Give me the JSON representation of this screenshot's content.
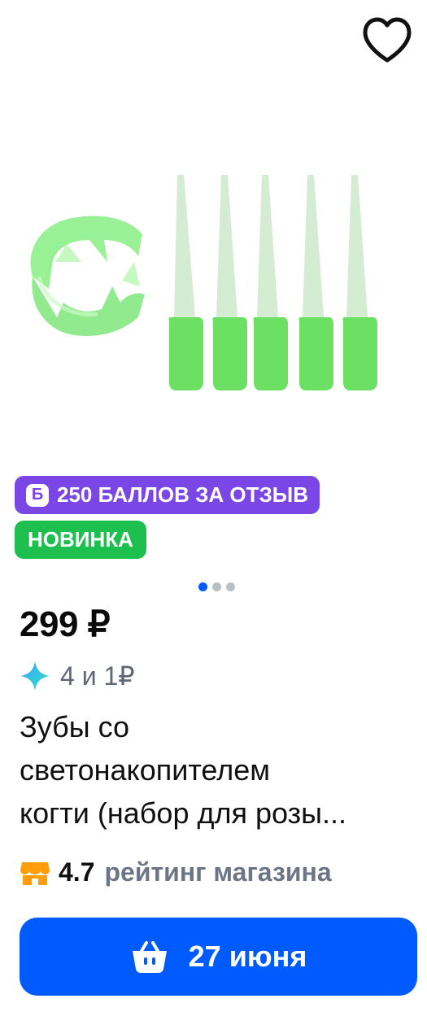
{
  "product": {
    "image_alt": "green glow-in-the-dark fangs and claws",
    "badges": {
      "points_icon": "Б",
      "points_label": "250 БАЛЛОВ ЗА ОТЗЫВ",
      "new_label": "НОВИНКА"
    },
    "carousel": {
      "total": 3,
      "active": 1
    },
    "price": "299 ₽",
    "cashback": "4 и 1₽",
    "title_lines": [
      "Зубы со",
      "светонакопителем",
      "когти (набор для розы..."
    ],
    "rating": {
      "score": "4.7",
      "label": "рейтинг магазина"
    },
    "delivery_button": "27 июня"
  },
  "colors": {
    "accent": "#005bff",
    "points_badge": "#7b46e6",
    "new_badge": "#1dbf4e",
    "product_green": "#7de37a"
  },
  "icons": [
    "heart-icon",
    "sparkle-icon",
    "store-icon",
    "basket-icon"
  ]
}
